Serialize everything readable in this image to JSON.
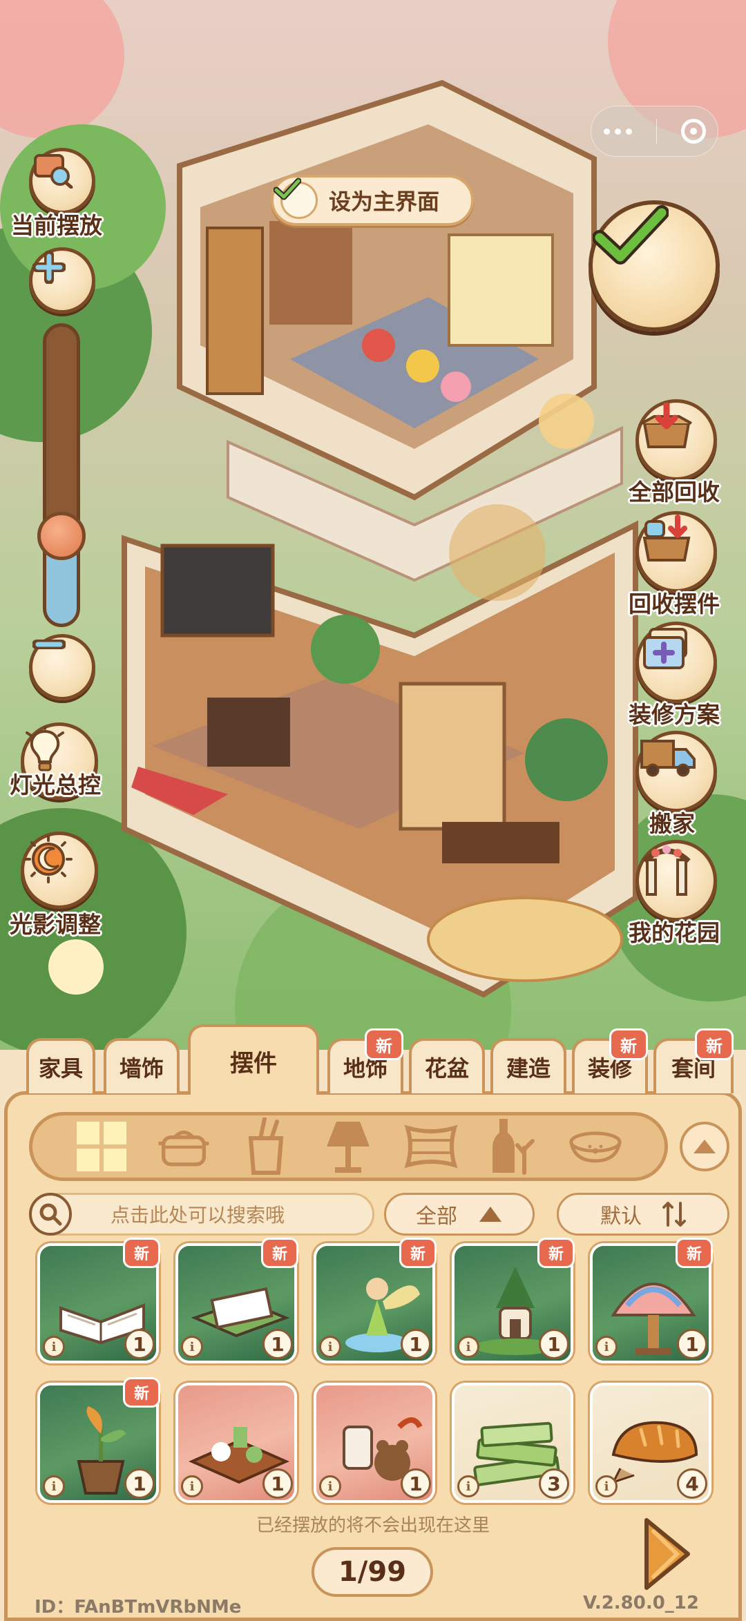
{
  "hud": {
    "set_main_label": "设为主界面",
    "current_placement": "当前摆放",
    "zoom_level": 0.3,
    "light_control": "灯光总控",
    "shadow_adjust": "光影调整"
  },
  "right_menu": [
    {
      "label": "全部回收",
      "icon": "recycle-all-icon"
    },
    {
      "label": "回收摆件",
      "icon": "recycle-ornament-icon"
    },
    {
      "label": "装修方案",
      "icon": "decoration-plan-icon"
    },
    {
      "label": "搬家",
      "icon": "moving-truck-icon"
    },
    {
      "label": "我的花园",
      "icon": "garden-arch-icon"
    }
  ],
  "tabs": [
    {
      "label": "家具",
      "active": false,
      "new": false
    },
    {
      "label": "墙饰",
      "active": false,
      "new": false
    },
    {
      "label": "摆件",
      "active": true,
      "new": false
    },
    {
      "label": "地饰",
      "active": false,
      "new": true
    },
    {
      "label": "花盆",
      "active": false,
      "new": false
    },
    {
      "label": "建造",
      "active": false,
      "new": false
    },
    {
      "label": "装修",
      "active": false,
      "new": true
    },
    {
      "label": "套间",
      "active": false,
      "new": true
    }
  ],
  "new_badge": "新",
  "subcategories": [
    "all-grid-icon",
    "pot-icon",
    "cup-icon",
    "lamp-icon",
    "pillow-icon",
    "bottle-icon",
    "pet-bowl-icon"
  ],
  "search": {
    "placeholder": "点击此处可以搜索哦"
  },
  "filter": {
    "label": "全部"
  },
  "sort": {
    "label": "默认"
  },
  "items": [
    {
      "name": "open-book",
      "count": "1",
      "new": true
    },
    {
      "name": "letter-box",
      "count": "1",
      "new": true
    },
    {
      "name": "fairy-figurine",
      "count": "1",
      "new": true
    },
    {
      "name": "tree-house",
      "count": "1",
      "new": true
    },
    {
      "name": "tiffany-lamp",
      "count": "1",
      "new": true
    },
    {
      "name": "sprout-pot",
      "count": "1",
      "new": true
    },
    {
      "name": "tea-table",
      "count": "1",
      "new": false
    },
    {
      "name": "bear-mug",
      "count": "1",
      "new": false
    },
    {
      "name": "green-books",
      "count": "3",
      "new": false
    },
    {
      "name": "bread-loaf",
      "count": "4",
      "new": false
    }
  ],
  "hint": "已经摆放的将不会出现在这里",
  "pager": "1/99",
  "footer": {
    "id": "ID：FAnBTmVRbNMe",
    "version": "V.2.80.0_12"
  },
  "colors": {
    "accent": "#c9935a",
    "badge": "#e76a4f",
    "text": "#5a2f17",
    "check": "#5fae3e"
  }
}
